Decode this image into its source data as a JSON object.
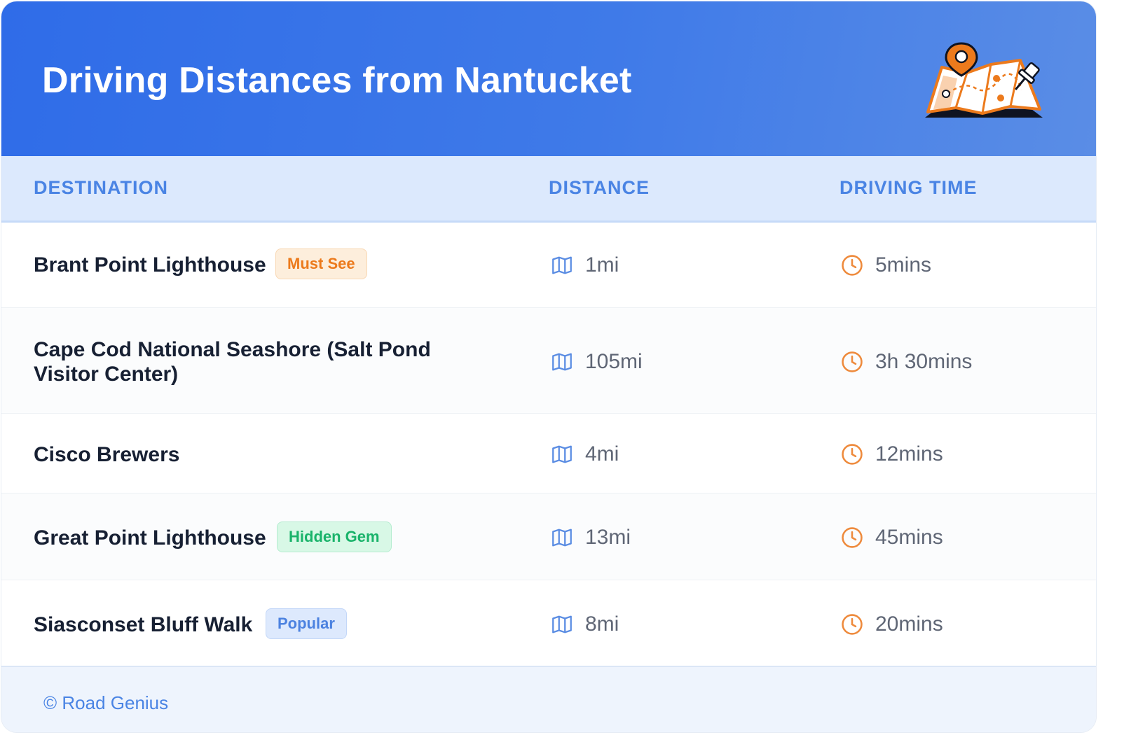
{
  "header": {
    "title": "Driving Distances from Nantucket",
    "illustration_icon": "map-with-location-pin-icon"
  },
  "table": {
    "columns": [
      "DESTINATION",
      "DISTANCE",
      "DRIVING TIME"
    ],
    "rows": [
      {
        "destination": "Brant Point Lighthouse",
        "badge": "Must See",
        "badge_color": "#ec7a1c",
        "distance": "1mi",
        "time": "5mins"
      },
      {
        "destination_line1": "Cape Cod National Seashore (Salt Pond",
        "destination_line2": "Visitor Center)",
        "distance": "105mi",
        "time": "3h 30mins"
      },
      {
        "destination": "Cisco Brewers",
        "distance": "4mi",
        "time": "12mins"
      },
      {
        "destination": "Great Point Lighthouse",
        "badge": "Hidden Gem",
        "badge_color": "#19b36a",
        "distance": "13mi",
        "time": "45mins"
      },
      {
        "destination": "Siasconset Bluff Walk",
        "badge": "Popular",
        "badge_color": "#4c82e0",
        "distance": "8mi",
        "time": "20mins"
      }
    ]
  },
  "icons": {
    "distance": "map-icon",
    "time": "clock-icon"
  },
  "footer": {
    "copyright": "© Road Genius"
  },
  "colors": {
    "header_start": "#2f6ce8",
    "header_end": "#5a8de6",
    "accent_blue": "#4a84e4",
    "accent_orange": "#ec7a1c"
  }
}
